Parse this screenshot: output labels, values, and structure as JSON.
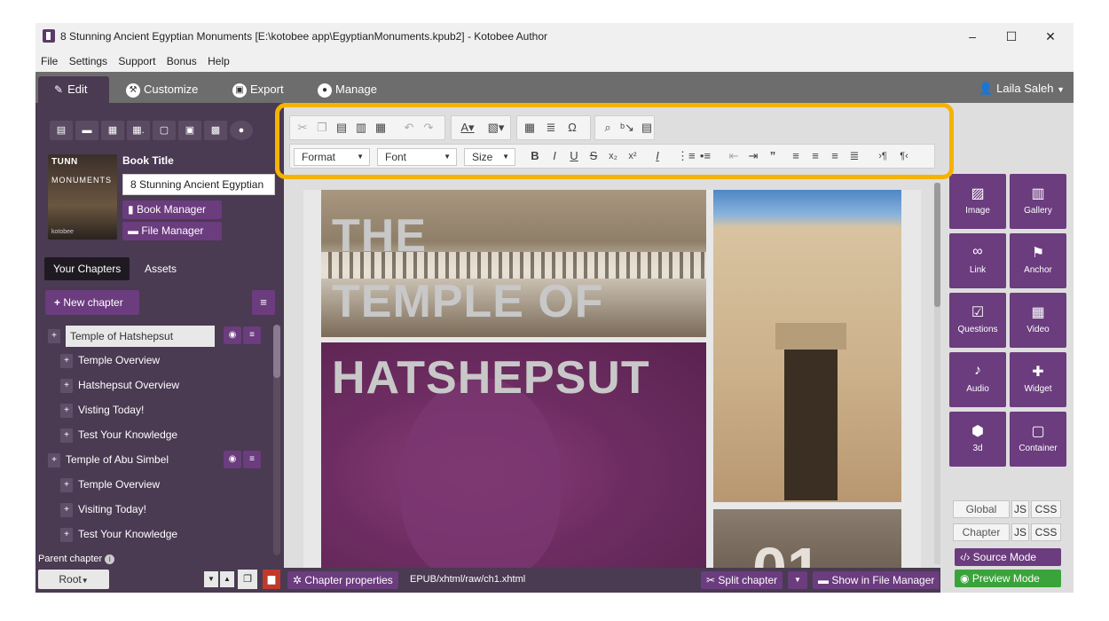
{
  "window": {
    "title": "8 Stunning Ancient Egyptian Monuments [E:\\kotobee app\\EgyptianMonuments.kpub2] - Kotobee Author",
    "controls": {
      "minimize": "–",
      "maximize": "☐",
      "close": "✕"
    }
  },
  "menu": [
    "File",
    "Settings",
    "Support",
    "Bonus",
    "Help"
  ],
  "tabs": [
    {
      "label": "Edit",
      "icon": "pencil-icon"
    },
    {
      "label": "Customize",
      "icon": "wrench-icon"
    },
    {
      "label": "Export",
      "icon": "export-icon"
    },
    {
      "label": "Manage",
      "icon": "user-icon"
    }
  ],
  "user": {
    "name": "Laila Saleh"
  },
  "sidebar": {
    "book_title_label": "Book Title",
    "book_title_value": "8 Stunning Ancient Egyptian",
    "book_manager": "Book Manager",
    "file_manager": "File Manager",
    "cover": {
      "line1": "TUNN",
      "line2": "MONUMENTS",
      "line3": "kotobee"
    },
    "subtabs": [
      "Your Chapters",
      "Assets"
    ],
    "new_chapter": "New chapter",
    "chapters": [
      {
        "label": "Temple of Hatshepsut",
        "level": 0,
        "selected": true
      },
      {
        "label": "Temple Overview",
        "level": 1
      },
      {
        "label": "Hatshepsut Overview",
        "level": 1
      },
      {
        "label": "Visting Today!",
        "level": 1
      },
      {
        "label": "Test Your Knowledge",
        "level": 1
      },
      {
        "label": "Temple of Abu Simbel",
        "level": 0
      },
      {
        "label": "Temple Overview",
        "level": 1
      },
      {
        "label": "Visiting Today!",
        "level": 1
      },
      {
        "label": "Test Your Knowledge",
        "level": 1
      }
    ],
    "parent_chapter_label": "Parent chapter",
    "root_select": "Root"
  },
  "toolbar": {
    "format": "Format",
    "font": "Font",
    "size": "Size"
  },
  "page": {
    "headline_lines": [
      "THE",
      "TEMPLE OF",
      "HATSHEPSUT"
    ],
    "number_fragment": "01"
  },
  "bottombar": {
    "chapter_properties": "Chapter properties",
    "path": "EPUB/xhtml/raw/ch1.xhtml",
    "split_chapter": "Split chapter",
    "show_in_file_manager": "Show in File Manager"
  },
  "insert_panel": [
    {
      "label": "Image",
      "icon": "image-icon"
    },
    {
      "label": "Gallery",
      "icon": "gallery-icon"
    },
    {
      "label": "Link",
      "icon": "link-icon"
    },
    {
      "label": "Anchor",
      "icon": "flag-icon"
    },
    {
      "label": "Questions",
      "icon": "checkbox-icon"
    },
    {
      "label": "Video",
      "icon": "film-icon"
    },
    {
      "label": "Audio",
      "icon": "microphone-icon"
    },
    {
      "label": "Widget",
      "icon": "puzzle-icon"
    },
    {
      "label": "3d",
      "icon": "cube-icon"
    },
    {
      "label": "Container",
      "icon": "square-icon"
    }
  ],
  "scope": {
    "global": "Global",
    "chapter": "Chapter",
    "js": "JS",
    "css": "CSS",
    "source_mode": "Source Mode",
    "preview_mode": "Preview Mode"
  },
  "colors": {
    "accent_purple": "#6b3c7e",
    "sidebar_bg": "#4a3a52",
    "highlight": "#f5b301",
    "preview_green": "#3aa33a"
  }
}
